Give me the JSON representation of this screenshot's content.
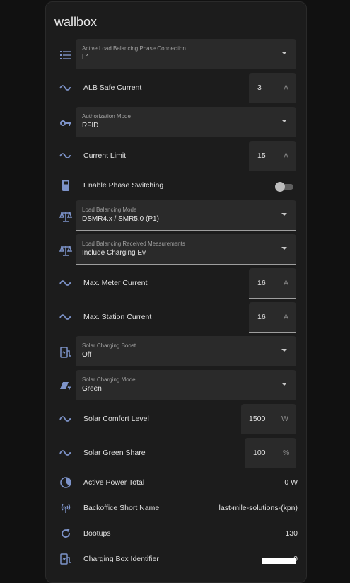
{
  "card": {
    "title": "wallbox"
  },
  "rows": {
    "alb_phase": {
      "label": "Active Load Balancing Phase Connection",
      "value": "L1"
    },
    "alb_safe_current": {
      "label": "ALB Safe Current",
      "value": "3",
      "unit": "A"
    },
    "authorization_mode": {
      "label": "Authorization Mode",
      "value": "RFID"
    },
    "current_limit": {
      "label": "Current Limit",
      "value": "15",
      "unit": "A"
    },
    "phase_switching": {
      "label": "Enable Phase Switching",
      "state": "off"
    },
    "load_balancing_mode": {
      "label": "Load Balancing Mode",
      "value": "DSMR4.x / SMR5.0 (P1)"
    },
    "lb_received_measurements": {
      "label": "Load Balancing Received Measurements",
      "value": "Include Charging Ev"
    },
    "max_meter_current": {
      "label": "Max. Meter Current",
      "value": "16",
      "unit": "A"
    },
    "max_station_current": {
      "label": "Max. Station Current",
      "value": "16",
      "unit": "A"
    },
    "solar_boost": {
      "label": "Solar Charging Boost",
      "value": "Off"
    },
    "solar_mode": {
      "label": "Solar Charging Mode",
      "value": "Green"
    },
    "solar_comfort": {
      "label": "Solar Comfort Level",
      "value": "1500",
      "unit": "W"
    },
    "solar_green_share": {
      "label": "Solar Green Share",
      "value": "100",
      "unit": "%"
    },
    "active_power": {
      "label": "Active Power Total",
      "value": "0 W"
    },
    "backoffice_name": {
      "label": "Backoffice Short Name",
      "value": "last-mile-solutions-(kpn)"
    },
    "bootups": {
      "label": "Bootups",
      "value": "130"
    },
    "box_identifier": {
      "label": "Charging Box Identifier",
      "value": "0"
    }
  },
  "icons": {
    "list": "format-list-icon",
    "sine": "sine-wave-icon",
    "key": "key-icon",
    "device": "ev-station-icon",
    "scale": "scale-balance-icon",
    "ev_plug": "ev-plug-charge-icon",
    "solar": "solar-power-icon",
    "gauge": "power-gauge-icon",
    "antenna": "broadcast-antenna-icon",
    "restart": "restart-icon"
  },
  "colors": {
    "icon": "#7d93c9",
    "background": "#111111",
    "card": "#1c1c1c",
    "field": "#2a2a2a"
  }
}
